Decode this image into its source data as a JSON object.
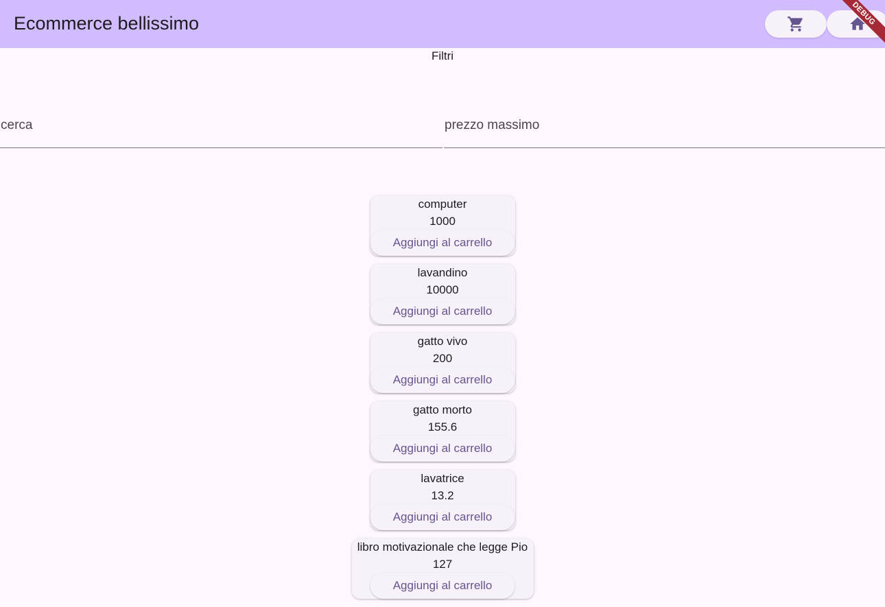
{
  "app": {
    "title": "Ecommerce bellissimo",
    "debug_label": "DEBUG"
  },
  "filters": {
    "heading": "Filtri",
    "search_placeholder": "cerca",
    "max_price_placeholder": "prezzo massimo"
  },
  "products": [
    {
      "name": "computer",
      "price": "1000",
      "button": "Aggiungi al carrello"
    },
    {
      "name": "lavandino",
      "price": "10000",
      "button": "Aggiungi al carrello"
    },
    {
      "name": "gatto vivo",
      "price": "200",
      "button": "Aggiungi al carrello"
    },
    {
      "name": "gatto morto",
      "price": "155.6",
      "button": "Aggiungi al carrello"
    },
    {
      "name": "lavatrice",
      "price": "13.2",
      "button": "Aggiungi al carrello"
    },
    {
      "name": "libro motivazionale che legge Pio",
      "price": "127",
      "button": "Aggiungi al carrello"
    }
  ],
  "icons": {
    "cart": "shopping-cart-icon",
    "home": "home-icon"
  },
  "colors": {
    "appbar": "#d1bcff",
    "background": "#fef7ff",
    "accent": "#65558f",
    "debug": "#a52a35"
  }
}
